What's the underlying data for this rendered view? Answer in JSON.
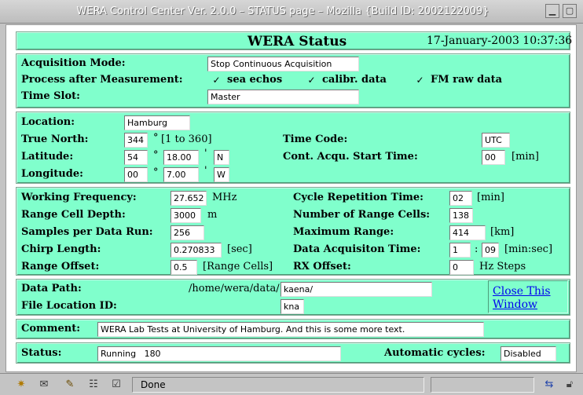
{
  "window": {
    "title": "WERA Control Center Ver. 2.0.0 – STATUS page – Mozilla {Build ID: 2002122009}"
  },
  "header": {
    "title": "WERA Status",
    "datetime": "17-January-2003 10:37:36"
  },
  "acq": {
    "mode_label": "Acquisition Mode:",
    "mode_value": "Stop Continuous Acquisition",
    "process_label": "Process after Measurement:",
    "sea_echos_label": "sea echos",
    "calibr_label": "calibr. data",
    "fm_raw_label": "FM raw data",
    "check_mark": "✓",
    "timeslot_label": "Time Slot:",
    "timeslot_value": "Master"
  },
  "location": {
    "location_label": "Location:",
    "location_value": "Hamburg",
    "true_north_label": "True North:",
    "true_north_value": "344",
    "deg": "°",
    "true_north_hint": "[1 to 360]",
    "latitude_label": "Latitude:",
    "lat_deg": "54",
    "lat_min": "18.00",
    "lat_hem": "N",
    "longitude_label": "Longitude:",
    "lon_deg": "00",
    "lon_min": "7.00",
    "lon_hem": "W",
    "minute_sym": "'",
    "timecode_label": "Time Code:",
    "timecode_value": "UTC",
    "cont_start_label": "Cont. Acqu. Start Time:",
    "cont_start_value": "00",
    "cont_start_unit": "[min]"
  },
  "params": {
    "wf_label": "Working Frequency:",
    "wf_value": "27.652",
    "wf_unit": "MHz",
    "rcd_label": "Range Cell Depth:",
    "rcd_value": "3000",
    "rcd_unit": "m",
    "spdr_label": "Samples per Data Run:",
    "spdr_value": "256",
    "chirp_label": "Chirp Length:",
    "chirp_value": "0.270833",
    "chirp_unit": "[sec]",
    "roff_label": "Range Offset:",
    "roff_value": "0.5",
    "roff_unit": "[Range Cells]",
    "crt_label": "Cycle Repetition Time:",
    "crt_value": "02",
    "crt_unit": "[min]",
    "nrc_label": "Number of Range Cells:",
    "nrc_value": "138",
    "mr_label": "Maximum Range:",
    "mr_value": "414",
    "mr_unit": "[km]",
    "dat_label": "Data Acquisiton Time:",
    "dat_min": "1",
    "dat_sep": ":",
    "dat_sec": "09",
    "dat_unit": "[min:sec]",
    "rx_label": "RX Offset:",
    "rx_value": "0",
    "rx_unit": "Hz Steps"
  },
  "path": {
    "data_path_label": "Data Path:",
    "data_path_prefix": "/home/wera/data/",
    "data_path_value": "kaena/",
    "file_loc_label": "File Location ID:",
    "file_loc_value": "kna",
    "close_line1": "Close This",
    "close_line2": "Window"
  },
  "comment": {
    "label": "Comment:",
    "value": "WERA Lab Tests at University of Hamburg. And this is some more text."
  },
  "status": {
    "label": "Status:",
    "value": "Running   180",
    "auto_label": "Automatic cycles:",
    "auto_value": "Disabled"
  },
  "statusbar": {
    "done": "Done"
  },
  "colors": {
    "panel": "#80ffcc",
    "link": "#0000ee"
  }
}
